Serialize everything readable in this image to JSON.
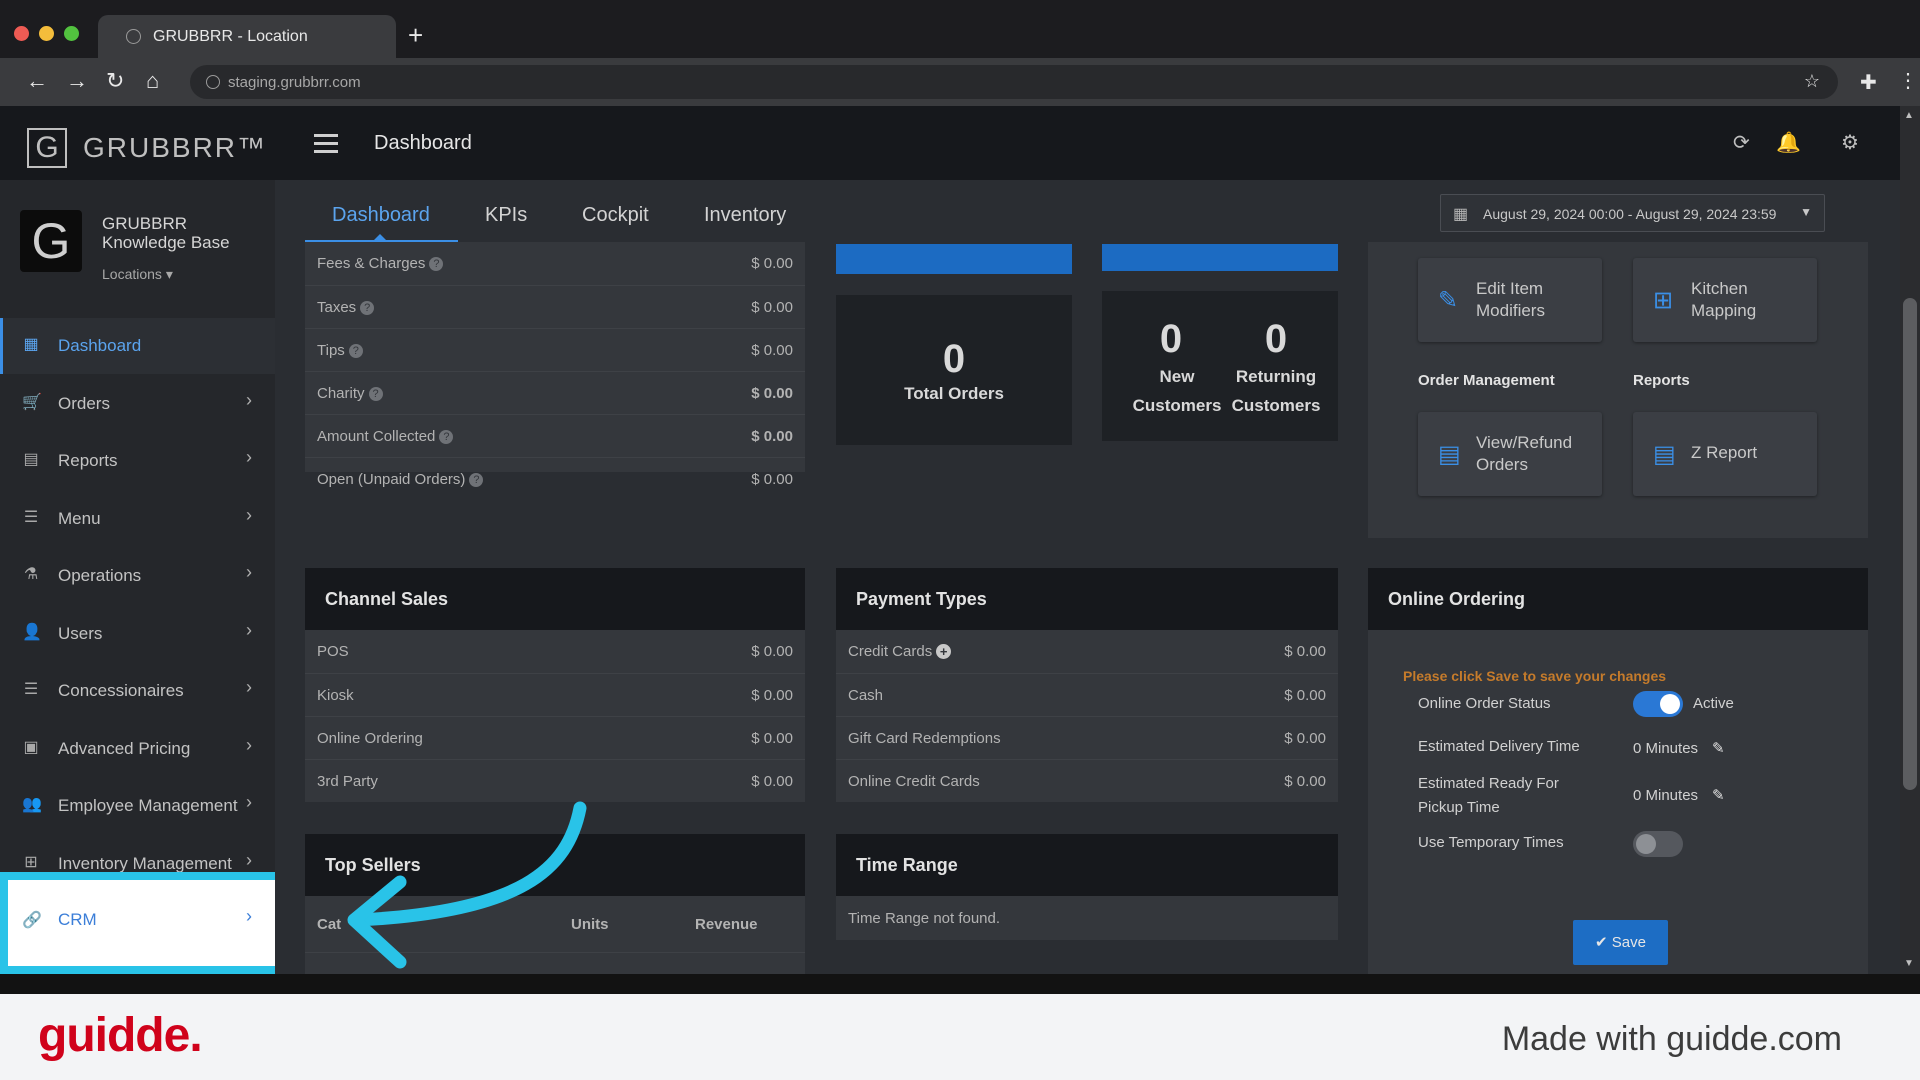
{
  "browser": {
    "tab_title": "GRUBBRR - Location",
    "new_tab": "+",
    "url": "staging.grubbrr.com",
    "back": "←",
    "forward": "→",
    "reload": "↻",
    "home": "⌂",
    "star": "☆",
    "extensions": "✚",
    "menu": "⋮"
  },
  "app": {
    "logo_mark": "G",
    "logo_text": "GRUBBRR™",
    "header_title": "Dashboard"
  },
  "sidebar": {
    "org_mark": "G",
    "org_name": "GRUBBRR Knowledge Base",
    "locations": "Locations ▾",
    "items": [
      {
        "label": "Dashboard",
        "icon": "dashboard-icon",
        "glyph": "▦",
        "active": true
      },
      {
        "label": "Orders",
        "icon": "cart-icon",
        "glyph": "🛒",
        "chev": "›"
      },
      {
        "label": "Reports",
        "icon": "report-icon",
        "glyph": "▤",
        "chev": "›"
      },
      {
        "label": "Menu",
        "icon": "list-icon",
        "glyph": "☰",
        "chev": "›"
      },
      {
        "label": "Operations",
        "icon": "flask-icon",
        "glyph": "⚗",
        "chev": "›"
      },
      {
        "label": "Users",
        "icon": "users-icon",
        "glyph": "👤",
        "chev": "›"
      },
      {
        "label": "Concessionaires",
        "icon": "list-icon",
        "glyph": "☰",
        "chev": "›"
      },
      {
        "label": "Advanced Pricing",
        "icon": "money-icon",
        "glyph": "▣",
        "chev": "›"
      },
      {
        "label": "Employee Management",
        "icon": "group-icon",
        "glyph": "👥",
        "chev": "›"
      },
      {
        "label": "Inventory Management",
        "icon": "sitemap-icon",
        "glyph": "⊞",
        "chev": "›"
      }
    ],
    "crm": {
      "label": "CRM",
      "icon": "link-icon",
      "glyph": "🔗",
      "chev": "›"
    }
  },
  "tabs": [
    "Dashboard",
    "KPIs",
    "Cockpit",
    "Inventory"
  ],
  "date_range": "August 29, 2024 00:00 - August 29, 2024 23:59",
  "summary_rows": [
    {
      "label": "Fees & Charges",
      "value": "$ 0.00"
    },
    {
      "label": "Taxes",
      "value": "$ 0.00"
    },
    {
      "label": "Tips",
      "value": "$ 0.00"
    },
    {
      "label": "Charity",
      "value": "$ 0.00"
    },
    {
      "label": "Amount Collected",
      "value": "$ 0.00"
    },
    {
      "label": "Open (Unpaid Orders)",
      "value": "$ 0.00"
    }
  ],
  "stats": {
    "total_orders": {
      "value": "0",
      "label": "Total Orders"
    },
    "new_customers": {
      "value": "0",
      "label": "New Customers"
    },
    "returning_customers": {
      "value": "0",
      "label": "Returning Customers"
    }
  },
  "quick_actions": {
    "edit_item_modifiers": "Edit Item Modifiers",
    "kitchen_mapping": "Kitchen Mapping",
    "order_management": "Order Management",
    "reports": "Reports",
    "view_refund_orders": "View/Refund Orders",
    "z_report": "Z Report"
  },
  "channel_sales": {
    "title": "Channel Sales",
    "rows": [
      {
        "label": "POS",
        "value": "$ 0.00"
      },
      {
        "label": "Kiosk",
        "value": "$ 0.00"
      },
      {
        "label": "Online Ordering",
        "value": "$ 0.00"
      },
      {
        "label": "3rd Party",
        "value": "$ 0.00"
      }
    ]
  },
  "payment_types": {
    "title": "Payment Types",
    "rows": [
      {
        "label": "Credit Cards",
        "value": "$ 0.00"
      },
      {
        "label": "Cash",
        "value": "$ 0.00"
      },
      {
        "label": "Gift Card Redemptions",
        "value": "$ 0.00"
      },
      {
        "label": "Online Credit Cards",
        "value": "$ 0.00"
      }
    ]
  },
  "online_ordering": {
    "title": "Online Ordering",
    "notice": "Please click Save to save your changes",
    "status_label": "Online Order Status",
    "status_value": "Active",
    "delivery_label": "Estimated Delivery Time",
    "delivery_value": "0 Minutes",
    "ready_label": "Estimated Ready For Pickup Time",
    "ready_value": "0 Minutes",
    "temp_label": "Use Temporary Times",
    "save": "✔ Save"
  },
  "top_sellers": {
    "title": "Top Sellers",
    "col_category": "Cat",
    "col_units": "Units",
    "col_revenue": "Revenue"
  },
  "time_range": {
    "title": "Time Range",
    "message": "Time Range not found."
  },
  "footer": {
    "brand": "guidde.",
    "made_with": "Made with guidde.com"
  },
  "colors": {
    "accent": "#3b8fe6",
    "highlight": "#29c3e8",
    "brand": "#d0021b"
  }
}
